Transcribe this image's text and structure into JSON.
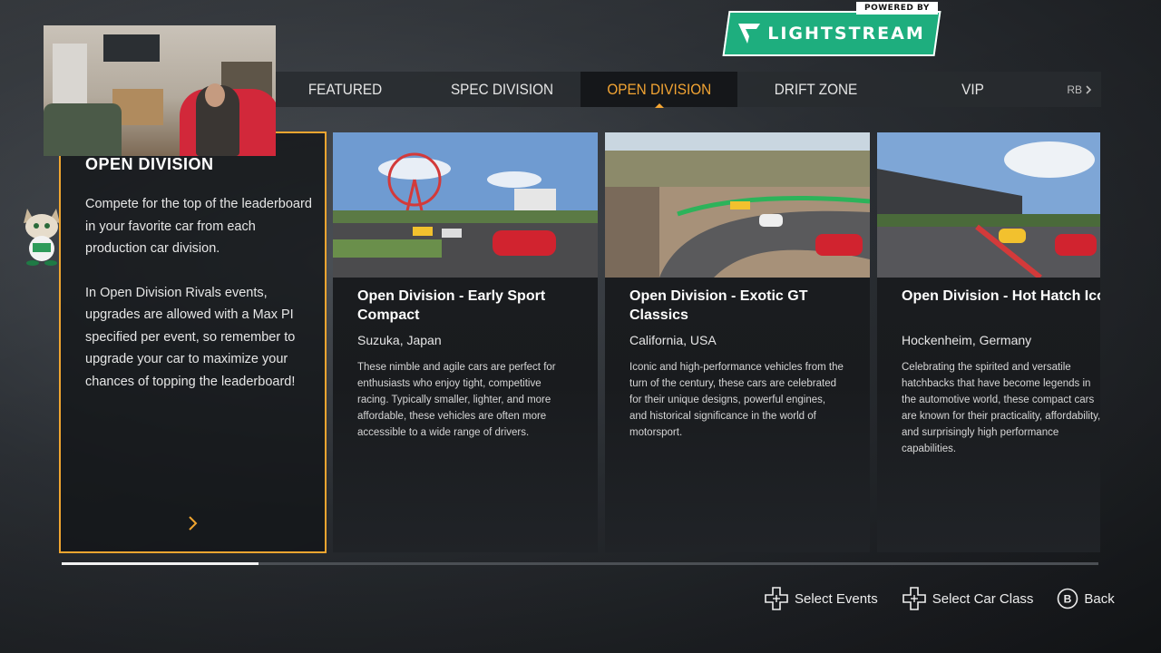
{
  "branding": {
    "powered_by": "POWERED BY",
    "logo_text": "LIGHTSTREAM",
    "logo_color": "#1eae7e"
  },
  "tabs": {
    "items": [
      {
        "label": "FEATURED"
      },
      {
        "label": "SPEC DIVISION"
      },
      {
        "label": "OPEN DIVISION",
        "active": true
      },
      {
        "label": "DRIFT ZONE"
      },
      {
        "label": "VIP"
      }
    ],
    "next_hint": "RB",
    "active_color": "#f4a533"
  },
  "intro": {
    "title": "OPEN DIVISION",
    "paragraph1": "Compete for the top of the leaderboard in your favorite car from each production car division.",
    "paragraph2": "In Open Division Rivals events, upgrades are allowed with a Max PI specified per event, so remember to upgrade your car to maximize your chances of topping the leaderboard!"
  },
  "cards": [
    {
      "title": "Open Division - Early Sport Compact",
      "location": "Suzuka, Japan",
      "description": "These nimble and agile cars are perfect for enthusiasts who enjoy tight, competitive racing. Typically smaller, lighter, and more affordable, these vehicles are often more accessible to a wide range of drivers."
    },
    {
      "title": "Open Division - Exotic GT Classics",
      "location": "California, USA",
      "description": "Iconic and high-performance vehicles from the turn of the century, these cars are celebrated for their unique designs, powerful engines, and historical significance in the world of motorsport."
    },
    {
      "title": "Open Division - Hot Hatch Icons",
      "location": "Hockenheim, Germany",
      "description": "Celebrating the spirited and versatile hatchbacks that have become legends in the automotive world, these compact cars are known for their practicality, affordability, and surprisingly high performance capabilities."
    }
  ],
  "progress": {
    "fraction": 0.19
  },
  "hints": {
    "select_events": "Select Events",
    "select_car_class": "Select Car Class",
    "back_key": "B",
    "back": "Back"
  }
}
